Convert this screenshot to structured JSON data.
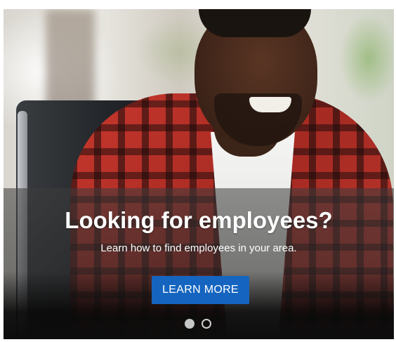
{
  "hero": {
    "headline": "Looking for employees?",
    "subheadline": "Learn how to find employees in your area.",
    "cta_label": "LEARN MORE",
    "photo_icon": "man-in-plaid-shirt-photo"
  },
  "pagination": {
    "total": 2,
    "active_index": 0
  },
  "colors": {
    "cta_background": "#1565c0",
    "text": "#ffffff",
    "overlay": "#1e1e1e"
  }
}
